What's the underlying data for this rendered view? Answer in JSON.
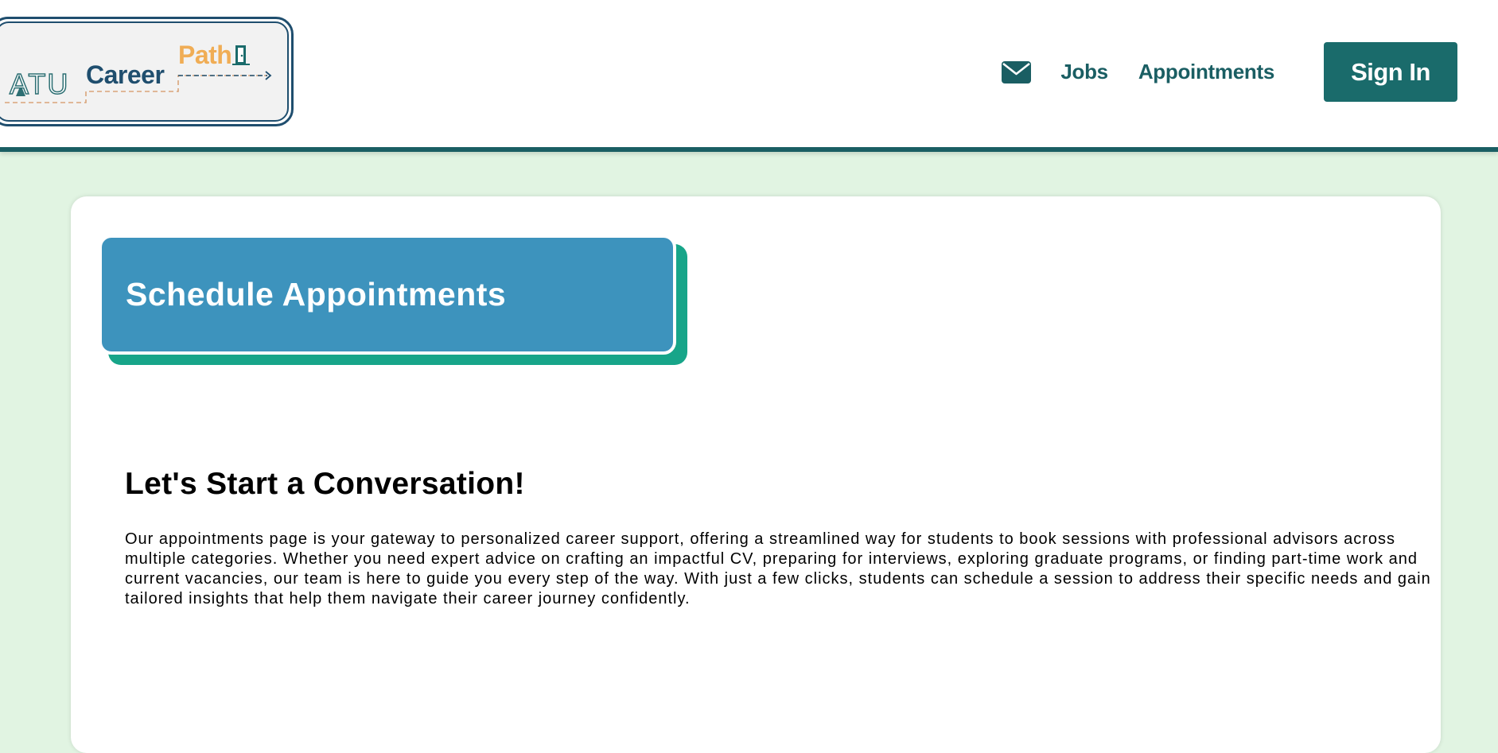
{
  "header": {
    "logo": {
      "atu": "ATU",
      "career": "Career",
      "path": "Path"
    },
    "nav": {
      "mail_icon": "envelope-icon",
      "jobs_label": "Jobs",
      "appointments_label": "Appointments",
      "signin_label": "Sign In"
    }
  },
  "main": {
    "title": "Schedule Appointments",
    "heading": "Let's Start a Conversation!",
    "body": "Our appointments page is your gateway to personalized career support, offering a streamlined way for students to book sessions with professional advisors across multiple categories. Whether you need expert advice on crafting an impactful CV, preparing for interviews, exploring graduate programs, or finding part-time work and current vacancies, our team is here to guide you every step of the way. With just a few clicks, students can schedule a session to address their specific needs and gain tailored insights that help them navigate their career journey confidently."
  },
  "colors": {
    "page_background": "#e1f4e2",
    "brand_teal": "#1a5e63",
    "signin_button": "#1a6b6b",
    "title_box": "#3d93bd",
    "title_shadow": "#17a589",
    "logo_path_orange": "#f0ad55",
    "logo_career_navy": "#1f4e6e"
  }
}
